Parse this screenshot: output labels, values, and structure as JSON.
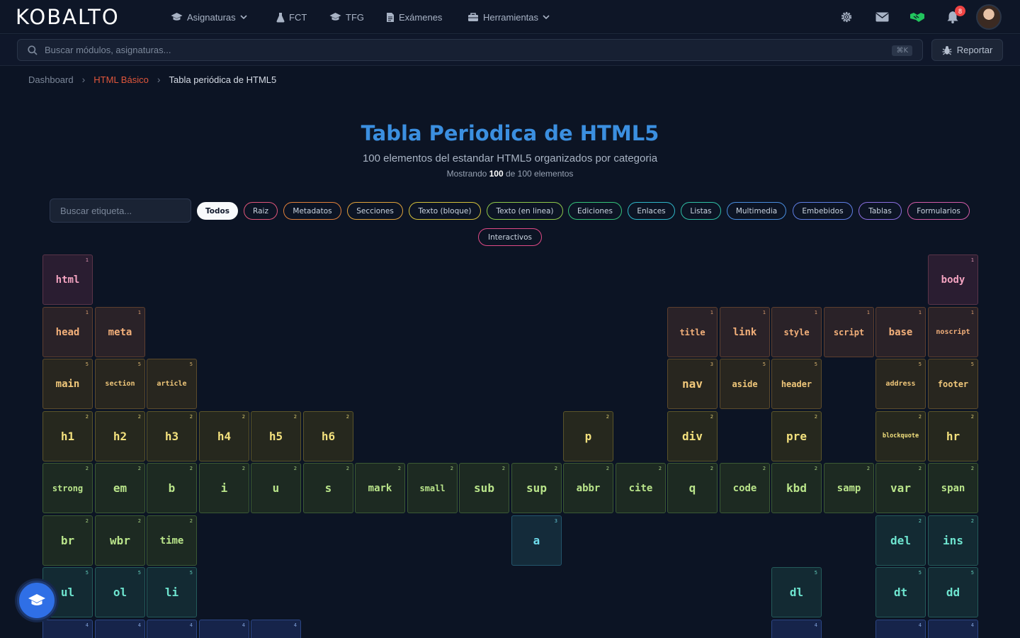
{
  "brand": {
    "logo": "KOBALTO"
  },
  "nav": {
    "items": [
      {
        "label": "Asignaturas",
        "icon": "graduation-cap-icon",
        "dropdown": true
      },
      {
        "label": "FCT",
        "icon": "flask-icon",
        "dropdown": false
      },
      {
        "label": "TFG",
        "icon": "graduation-cap-icon",
        "dropdown": false
      },
      {
        "label": "Exámenes",
        "icon": "document-icon",
        "dropdown": false
      },
      {
        "label": "Herramientas",
        "icon": "toolbox-icon",
        "dropdown": true
      }
    ],
    "notification_count": "8"
  },
  "search": {
    "placeholder": "Buscar módulos, asignaturas...",
    "shortcut": "⌘K",
    "report_label": "Reportar"
  },
  "breadcrumb": {
    "items": [
      "Dashboard",
      "HTML Básico"
    ],
    "current": "Tabla periódica de HTML5"
  },
  "header": {
    "title": "Tabla Periodica de HTML5",
    "subtitle": "100 elementos del estandar HTML5 organizados por categoria",
    "showing_prefix": "Mostrando ",
    "showing_count": "100",
    "showing_suffix": " de 100 elementos"
  },
  "filters": {
    "search_placeholder": "Buscar etiqueta...",
    "chips": [
      {
        "label": "Todos",
        "color": "#f8fafc",
        "active": true
      },
      {
        "label": "Raiz",
        "color": "#e0567a"
      },
      {
        "label": "Metadatos",
        "color": "#e0803b"
      },
      {
        "label": "Secciones",
        "color": "#e0a23b"
      },
      {
        "label": "Texto (bloque)",
        "color": "#d4c13b"
      },
      {
        "label": "Texto (en linea)",
        "color": "#8fc94a"
      },
      {
        "label": "Ediciones",
        "color": "#35c27a"
      },
      {
        "label": "Enlaces",
        "color": "#2fb7c9"
      },
      {
        "label": "Listas",
        "color": "#2fbfa6"
      },
      {
        "label": "Multimedia",
        "color": "#4a8ee0"
      },
      {
        "label": "Embebidos",
        "color": "#5f7fe6"
      },
      {
        "label": "Tablas",
        "color": "#8b6fe0"
      },
      {
        "label": "Formularios",
        "color": "#d35ca8"
      },
      {
        "label": "Interactivos",
        "color": "#e04a86"
      }
    ]
  },
  "categories": {
    "1": {
      "bg": "#2a1d31",
      "border": "#5a3448",
      "text": "#f3a3c0"
    },
    "m": {
      "bg": "#2a2228",
      "border": "#5e3f2f",
      "text": "#f3b07a"
    },
    "5": {
      "bg": "#28261f",
      "border": "#5d4b2b",
      "text": "#f0c77a"
    },
    "2": {
      "bg": "#26281e",
      "border": "#5a5429",
      "text": "#f2e07d"
    },
    "i": {
      "bg": "#1d2a22",
      "border": "#3b5a33",
      "text": "#b9e48a"
    },
    "3": {
      "bg": "#142b3a",
      "border": "#23566c",
      "text": "#6fdcec"
    },
    "l": {
      "bg": "#132a33",
      "border": "#245b5a",
      "text": "#6ee4cf"
    },
    "4": {
      "bg": "#16244a",
      "border": "#2c4685",
      "text": "#93b7f2"
    }
  },
  "elements": [
    {
      "tag": "html",
      "group": "1",
      "row": 0,
      "col": 0
    },
    {
      "tag": "body",
      "group": "1",
      "row": 0,
      "col": 17
    },
    {
      "tag": "head",
      "group": "m",
      "row": 1,
      "col": 0
    },
    {
      "tag": "meta",
      "group": "m",
      "row": 1,
      "col": 1
    },
    {
      "tag": "title",
      "group": "m",
      "row": 1,
      "col": 12
    },
    {
      "tag": "link",
      "group": "m",
      "row": 1,
      "col": 13
    },
    {
      "tag": "style",
      "group": "m",
      "row": 1,
      "col": 14
    },
    {
      "tag": "script",
      "group": "m",
      "row": 1,
      "col": 15
    },
    {
      "tag": "base",
      "group": "m",
      "row": 1,
      "col": 16
    },
    {
      "tag": "noscript",
      "group": "m",
      "row": 1,
      "col": 17
    },
    {
      "tag": "main",
      "group": "5",
      "row": 2,
      "col": 0
    },
    {
      "tag": "section",
      "group": "5",
      "row": 2,
      "col": 1
    },
    {
      "tag": "article",
      "group": "5",
      "row": 2,
      "col": 2
    },
    {
      "tag": "nav",
      "group": "5",
      "row": 2,
      "col": 12,
      "num": "3"
    },
    {
      "tag": "aside",
      "group": "5",
      "row": 2,
      "col": 13
    },
    {
      "tag": "header",
      "group": "5",
      "row": 2,
      "col": 14
    },
    {
      "tag": "address",
      "group": "5",
      "row": 2,
      "col": 16
    },
    {
      "tag": "footer",
      "group": "5",
      "row": 2,
      "col": 17
    },
    {
      "tag": "h1",
      "group": "2",
      "row": 3,
      "col": 0
    },
    {
      "tag": "h2",
      "group": "2",
      "row": 3,
      "col": 1
    },
    {
      "tag": "h3",
      "group": "2",
      "row": 3,
      "col": 2
    },
    {
      "tag": "h4",
      "group": "2",
      "row": 3,
      "col": 3
    },
    {
      "tag": "h5",
      "group": "2",
      "row": 3,
      "col": 4
    },
    {
      "tag": "h6",
      "group": "2",
      "row": 3,
      "col": 5
    },
    {
      "tag": "p",
      "group": "2",
      "row": 3,
      "col": 10
    },
    {
      "tag": "div",
      "group": "2",
      "row": 3,
      "col": 12
    },
    {
      "tag": "pre",
      "group": "2",
      "row": 3,
      "col": 14
    },
    {
      "tag": "blockquote",
      "group": "2",
      "row": 3,
      "col": 16
    },
    {
      "tag": "hr",
      "group": "2",
      "row": 3,
      "col": 17
    },
    {
      "tag": "strong",
      "group": "i",
      "row": 4,
      "col": 0
    },
    {
      "tag": "em",
      "group": "i",
      "row": 4,
      "col": 1
    },
    {
      "tag": "b",
      "group": "i",
      "row": 4,
      "col": 2
    },
    {
      "tag": "i",
      "group": "i",
      "row": 4,
      "col": 3
    },
    {
      "tag": "u",
      "group": "i",
      "row": 4,
      "col": 4
    },
    {
      "tag": "s",
      "group": "i",
      "row": 4,
      "col": 5
    },
    {
      "tag": "mark",
      "group": "i",
      "row": 4,
      "col": 6
    },
    {
      "tag": "small",
      "group": "i",
      "row": 4,
      "col": 7
    },
    {
      "tag": "sub",
      "group": "i",
      "row": 4,
      "col": 8
    },
    {
      "tag": "sup",
      "group": "i",
      "row": 4,
      "col": 9
    },
    {
      "tag": "abbr",
      "group": "i",
      "row": 4,
      "col": 10
    },
    {
      "tag": "cite",
      "group": "i",
      "row": 4,
      "col": 11
    },
    {
      "tag": "q",
      "group": "i",
      "row": 4,
      "col": 12
    },
    {
      "tag": "code",
      "group": "i",
      "row": 4,
      "col": 13
    },
    {
      "tag": "kbd",
      "group": "i",
      "row": 4,
      "col": 14
    },
    {
      "tag": "samp",
      "group": "i",
      "row": 4,
      "col": 15
    },
    {
      "tag": "var",
      "group": "i",
      "row": 4,
      "col": 16
    },
    {
      "tag": "span",
      "group": "i",
      "row": 4,
      "col": 17
    },
    {
      "tag": "br",
      "group": "i",
      "row": 5,
      "col": 0
    },
    {
      "tag": "wbr",
      "group": "i",
      "row": 5,
      "col": 1
    },
    {
      "tag": "time",
      "group": "i",
      "row": 5,
      "col": 2
    },
    {
      "tag": "a",
      "group": "3",
      "row": 5,
      "col": 9
    },
    {
      "tag": "del",
      "group": "l",
      "row": 5,
      "col": 16,
      "num": "2"
    },
    {
      "tag": "ins",
      "group": "l",
      "row": 5,
      "col": 17,
      "num": "2"
    },
    {
      "tag": "ul",
      "group": "l",
      "row": 6,
      "col": 0
    },
    {
      "tag": "ol",
      "group": "l",
      "row": 6,
      "col": 1
    },
    {
      "tag": "li",
      "group": "l",
      "row": 6,
      "col": 2
    },
    {
      "tag": "dl",
      "group": "l",
      "row": 6,
      "col": 14
    },
    {
      "tag": "dt",
      "group": "l",
      "row": 6,
      "col": 16
    },
    {
      "tag": "dd",
      "group": "l",
      "row": 6,
      "col": 17
    },
    {
      "tag": "",
      "group": "4",
      "row": 7,
      "col": 0
    },
    {
      "tag": "",
      "group": "4",
      "row": 7,
      "col": 1
    },
    {
      "tag": "",
      "group": "4",
      "row": 7,
      "col": 2
    },
    {
      "tag": "",
      "group": "4",
      "row": 7,
      "col": 3
    },
    {
      "tag": "",
      "group": "4",
      "row": 7,
      "col": 4
    },
    {
      "tag": "",
      "group": "4",
      "row": 7,
      "col": 14
    },
    {
      "tag": "",
      "group": "4",
      "row": 7,
      "col": 16
    },
    {
      "tag": "",
      "group": "4",
      "row": 7,
      "col": 17
    }
  ]
}
